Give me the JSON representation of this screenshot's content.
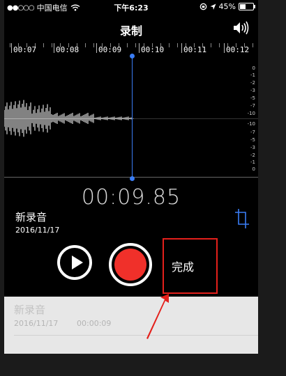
{
  "status_bar": {
    "signal": "●●○○○",
    "carrier": "中国电信",
    "time": "下午6:23",
    "battery": "45%",
    "battery_level": 0.45
  },
  "header": {
    "title": "录制"
  },
  "timeline": {
    "labels": [
      "00:07",
      "00:08",
      "00:09",
      "00:10",
      "00:11",
      "00:12"
    ]
  },
  "db_scale": [
    "0",
    "-1",
    "-2",
    "-3",
    "-5",
    "-7",
    "-10",
    "-10",
    "-7",
    "-5",
    "-3",
    "-2",
    "-1",
    "0"
  ],
  "player": {
    "elapsed": "00:09.85"
  },
  "current_recording": {
    "name": "新录音",
    "date": "2016/11/17"
  },
  "controls": {
    "done_label": "完成"
  },
  "recordings": [
    {
      "name": "新录音",
      "date": "2016/11/17",
      "duration": "00:00:09"
    }
  ],
  "colors": {
    "record": "#f0302a",
    "playhead": "#3a7df5",
    "annotation": "#e4201b"
  }
}
